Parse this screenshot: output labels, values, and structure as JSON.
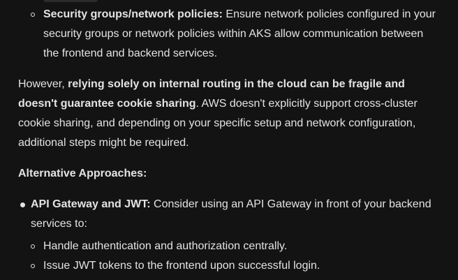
{
  "security_item": {
    "bold": "Security groups/network policies:",
    "line1_rest": " Ensure network policies configured in your",
    "line2": "security groups or network policies within AKS allow communication between",
    "line3": "the frontend and backend services."
  },
  "however_para": {
    "lead": "However, ",
    "bold_line1": "relying solely on internal routing in the cloud can be fragile and",
    "bold_line2": "doesn't guarantee cookie sharing",
    "line2_rest": ". AWS doesn't explicitly support cross-cluster",
    "line3": "cookie sharing, and depending on your specific setup and network configuration,",
    "line4": "additional steps might be required."
  },
  "alt_heading": "Alternative Approaches:",
  "api_item": {
    "bold": "API Gateway and JWT:",
    "line1_rest": " Consider using an API Gateway in front of your backend",
    "line2": "services to:"
  },
  "sub_items": [
    "Handle authentication and authorization centrally.",
    "Issue JWT tokens to the frontend upon successful login."
  ]
}
